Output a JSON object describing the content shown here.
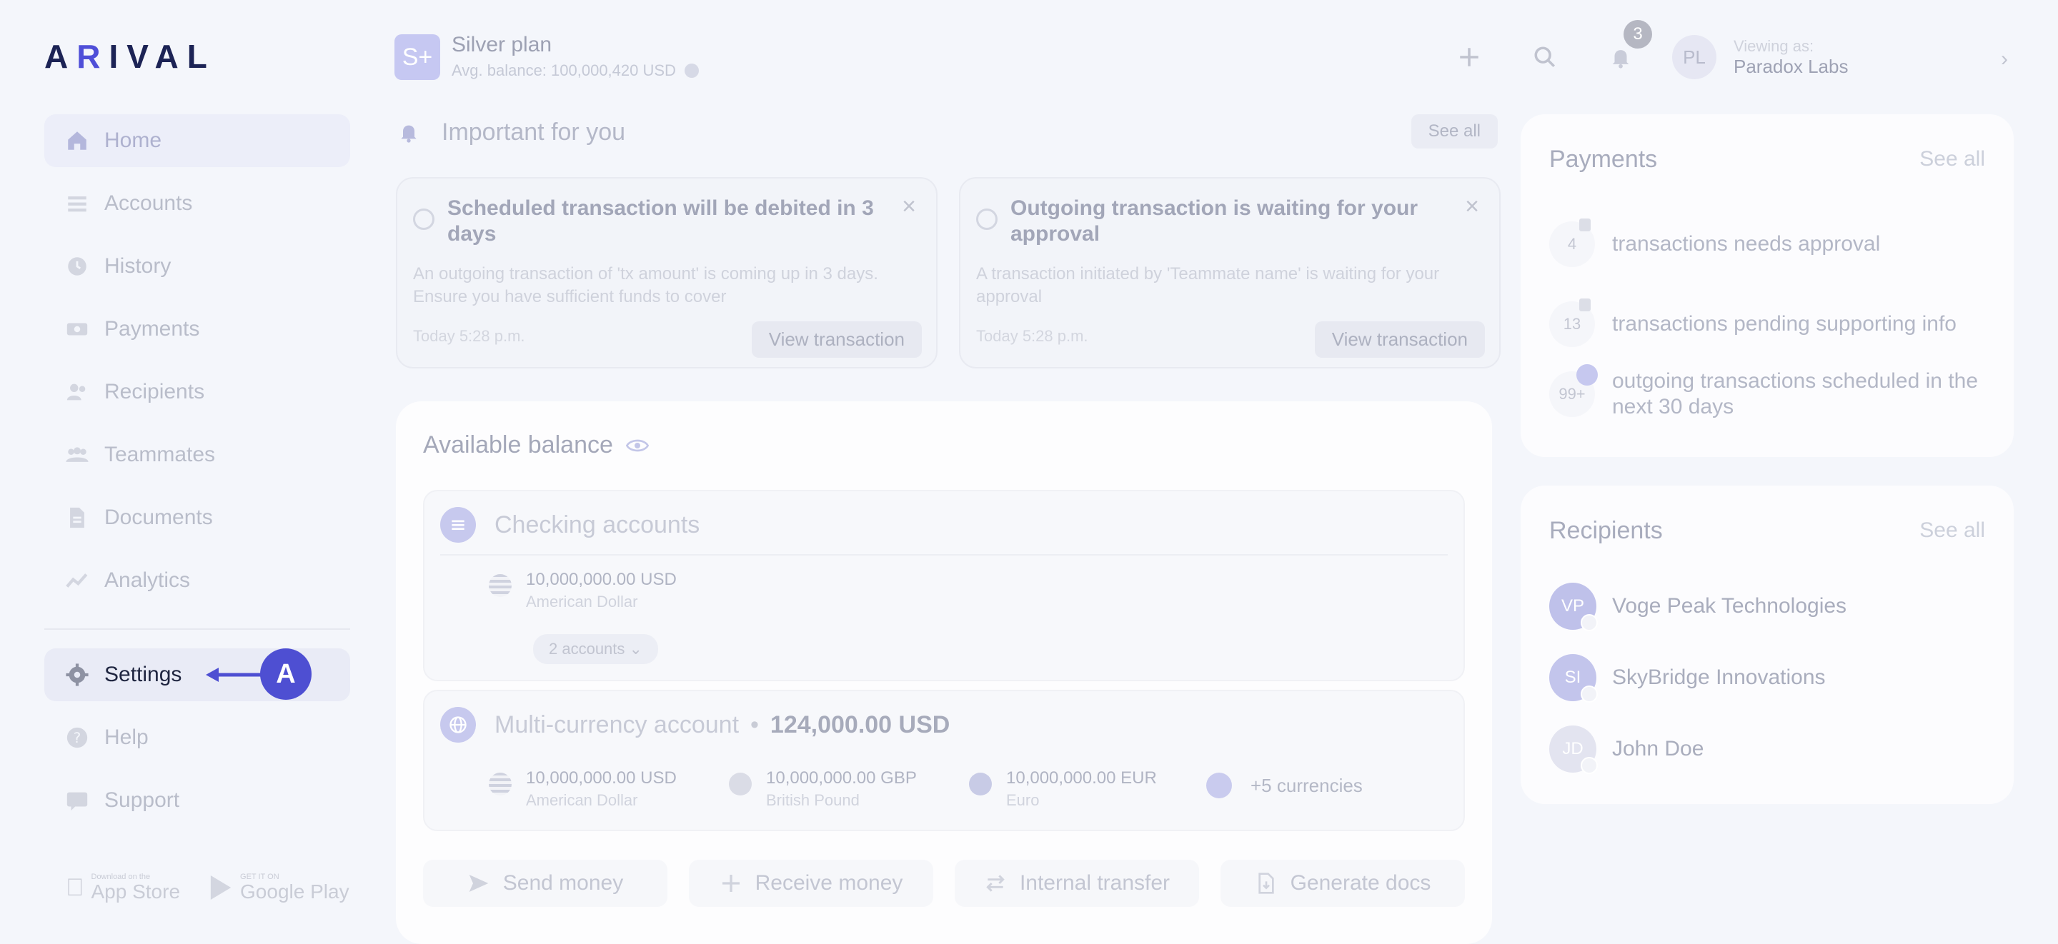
{
  "brand": {
    "logo_pre": "A",
    "logo_accent": "R",
    "logo_post": "IVAL"
  },
  "sidebar": {
    "items": [
      {
        "label": "Home",
        "icon": "home-icon"
      },
      {
        "label": "Accounts",
        "icon": "accounts-icon"
      },
      {
        "label": "History",
        "icon": "history-icon"
      },
      {
        "label": "Payments",
        "icon": "payments-icon"
      },
      {
        "label": "Recipients",
        "icon": "recipients-icon"
      },
      {
        "label": "Teammates",
        "icon": "teammates-icon"
      },
      {
        "label": "Documents",
        "icon": "documents-icon"
      },
      {
        "label": "Analytics",
        "icon": "analytics-icon"
      }
    ],
    "settings_label": "Settings",
    "help_label": "Help",
    "support_label": "Support",
    "callout_letter": "A",
    "stores": {
      "apple_small": "Download on the",
      "apple_big": "App Store",
      "google_small": "GET IT ON",
      "google_big": "Google Play"
    }
  },
  "topbar": {
    "plan_badge": "S+",
    "plan_name": "Silver plan",
    "plan_balance": "Avg. balance: 100,000,420 USD",
    "notification_count": "3",
    "avatar_initials": "PL",
    "viewing_label": "Viewing as:",
    "viewing_name": "Paradox Labs"
  },
  "important": {
    "title": "Important for you",
    "see_all": "See all",
    "notices": [
      {
        "title": "Scheduled transaction will be debited in 3 days",
        "body": "An outgoing transaction of 'tx amount' is coming up in 3 days. Ensure you have sufficient funds to cover",
        "time": "Today 5:28 p.m.",
        "button": "View transaction"
      },
      {
        "title": "Outgoing transaction is waiting for your approval",
        "body": "A transaction initiated by 'Teammate name' is waiting for your approval",
        "time": "Today 5:28 p.m.",
        "button": "View transaction"
      }
    ]
  },
  "balance": {
    "title": "Available balance",
    "checking": {
      "title": "Checking accounts",
      "amount": "10,000,000.00 USD",
      "currency": "American Dollar",
      "accounts_pill": "2 accounts"
    },
    "multi": {
      "title": "Multi-currency account",
      "total": "124,000.00 USD",
      "currencies": [
        {
          "amount": "10,000,000.00 USD",
          "name": "American Dollar"
        },
        {
          "amount": "10,000,000.00 GBP",
          "name": "British Pound"
        },
        {
          "amount": "10,000,000.00 EUR",
          "name": "Euro"
        }
      ],
      "more": "+5 currencies"
    },
    "actions": {
      "send": "Send money",
      "receive": "Receive money",
      "internal": "Internal transfer",
      "docs": "Generate docs"
    }
  },
  "payments": {
    "title": "Payments",
    "see_all": "See all",
    "rows": [
      {
        "count": "4",
        "text": "transactions needs approval"
      },
      {
        "count": "13",
        "text": "transactions pending supporting info"
      },
      {
        "count": "99+",
        "text": "outgoing transactions scheduled in the next 30 days"
      }
    ]
  },
  "recipients": {
    "title": "Recipients",
    "see_all": "See all",
    "rows": [
      {
        "initials": "VP",
        "name": "Voge Peak Technologies",
        "color": "#bfc1ea"
      },
      {
        "initials": "SI",
        "name": "SkyBridge Innovations",
        "color": "#c3c5ec"
      },
      {
        "initials": "JD",
        "name": "John Doe",
        "color": "#e3e4f0"
      }
    ]
  },
  "colors": {
    "accent": "#4e4fd2",
    "brand_navy": "#1c2355"
  }
}
